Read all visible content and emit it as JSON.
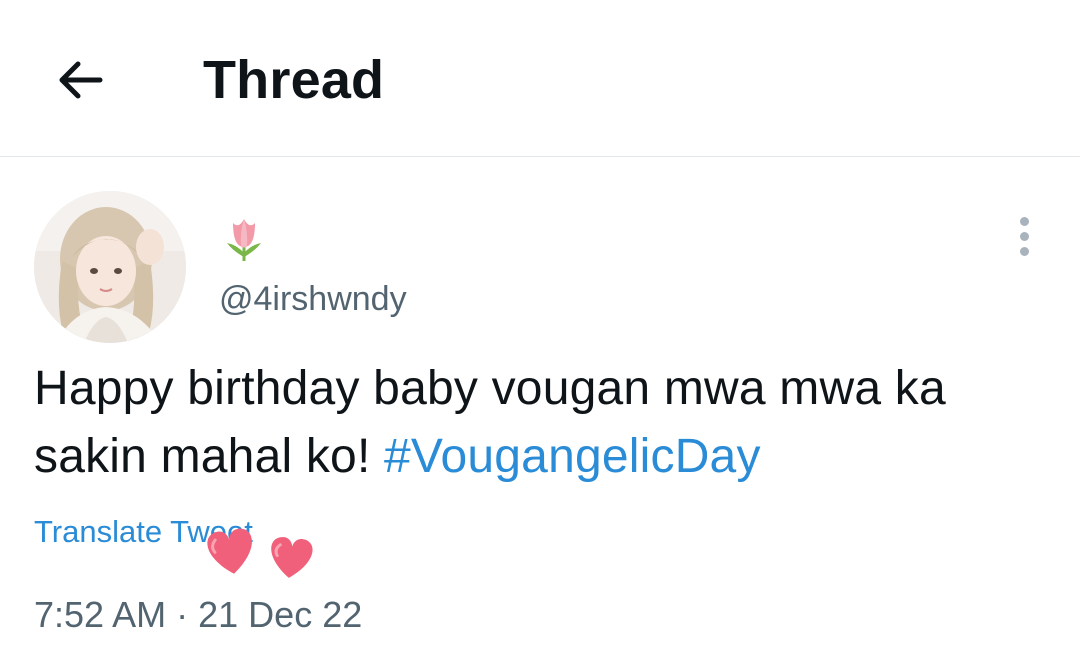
{
  "header": {
    "back_icon": "arrow-left-icon",
    "title": "Thread"
  },
  "tweet": {
    "avatar_icon": "profile-photo",
    "display_name_icon": "tulip-emoji",
    "handle": "@4irshwndy",
    "more_icon": "more-vertical-icon",
    "text_plain": "Happy birthday baby vougan mwa mwa ka sakin mahal ko! ",
    "hashtag": "#VougangelicDay",
    "translate_label": "Translate Tweet",
    "sticker_icon": "hearts-sticker",
    "time": "7:52 AM",
    "separator": "·",
    "date": "21 Dec 22"
  },
  "colors": {
    "link": "#2a8bd6",
    "secondary_text": "#536471",
    "heart": "#f0607a"
  }
}
